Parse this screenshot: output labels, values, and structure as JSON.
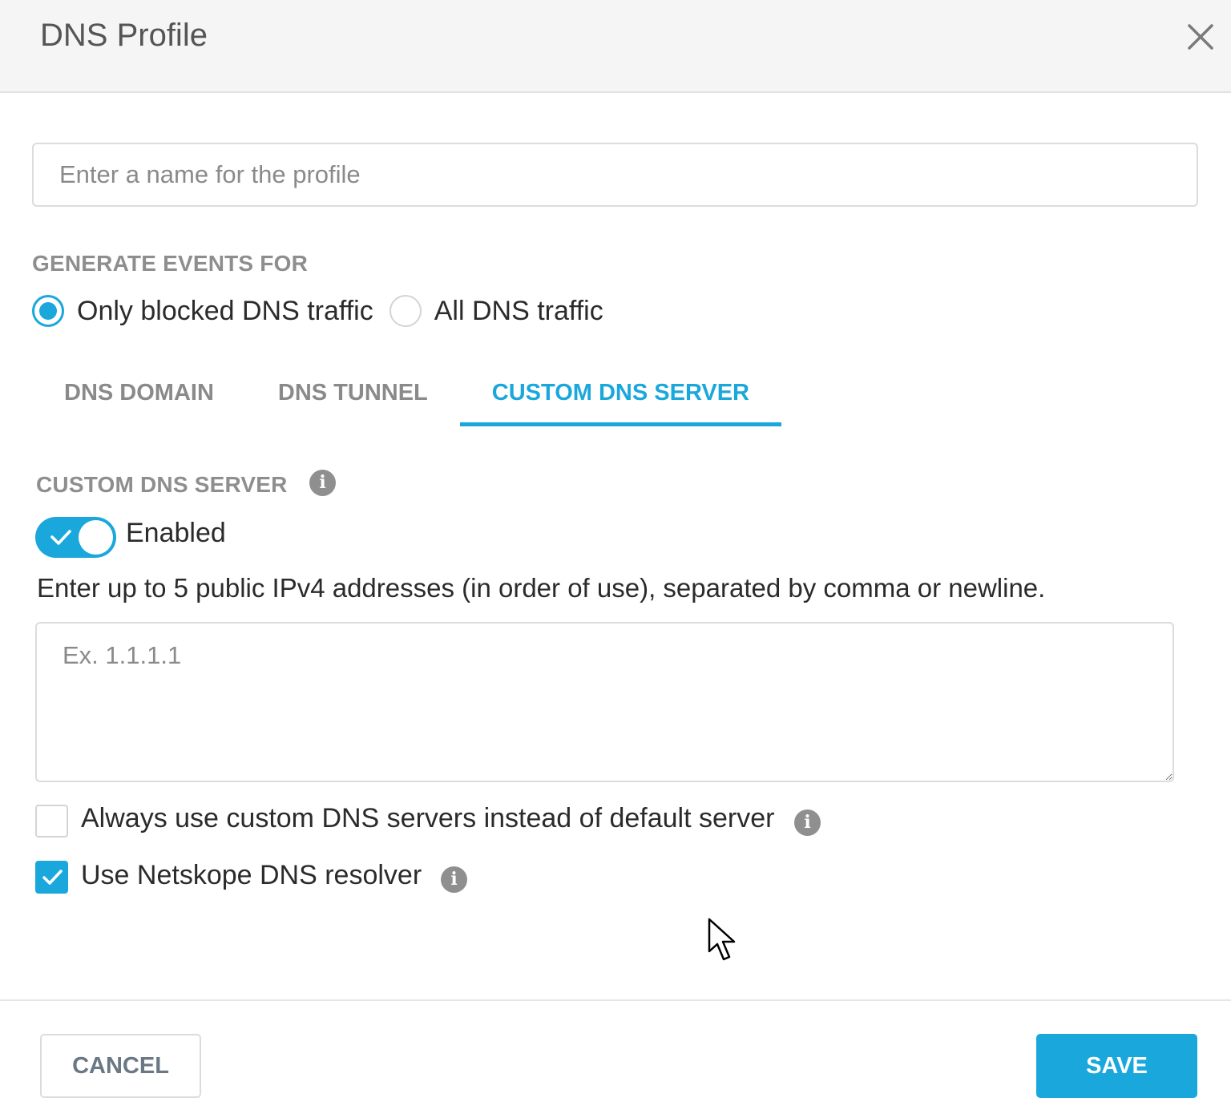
{
  "dialog": {
    "title": "DNS Profile",
    "close_icon": "close-icon"
  },
  "profile_name": {
    "value": "",
    "placeholder": "Enter a name for the profile"
  },
  "events": {
    "label": "GENERATE EVENTS FOR",
    "options": [
      {
        "label": "Only blocked DNS traffic",
        "selected": true
      },
      {
        "label": "All DNS traffic",
        "selected": false
      }
    ]
  },
  "tabs": [
    {
      "label": "DNS DOMAIN",
      "active": false
    },
    {
      "label": "DNS TUNNEL",
      "active": false
    },
    {
      "label": "CUSTOM DNS SERVER",
      "active": true
    }
  ],
  "custom_dns": {
    "section_label": "CUSTOM DNS SERVER",
    "info_icon": "info-icon",
    "toggle": {
      "label": "Enabled",
      "on": true
    },
    "help_text": "Enter up to 5 public IPv4 addresses (in order of use), separated by comma or newline.",
    "ip_addresses": {
      "value": "",
      "placeholder": "Ex. 1.1.1.1"
    },
    "checkboxes": [
      {
        "label": "Always use custom DNS servers instead of default server",
        "checked": false
      },
      {
        "label": "Use Netskope DNS resolver",
        "checked": true
      }
    ]
  },
  "footer": {
    "cancel_label": "CANCEL",
    "save_label": "SAVE"
  },
  "colors": {
    "accent": "#1aa8dc",
    "muted_label": "#8e8e8e",
    "header_bg": "#f5f5f5"
  }
}
